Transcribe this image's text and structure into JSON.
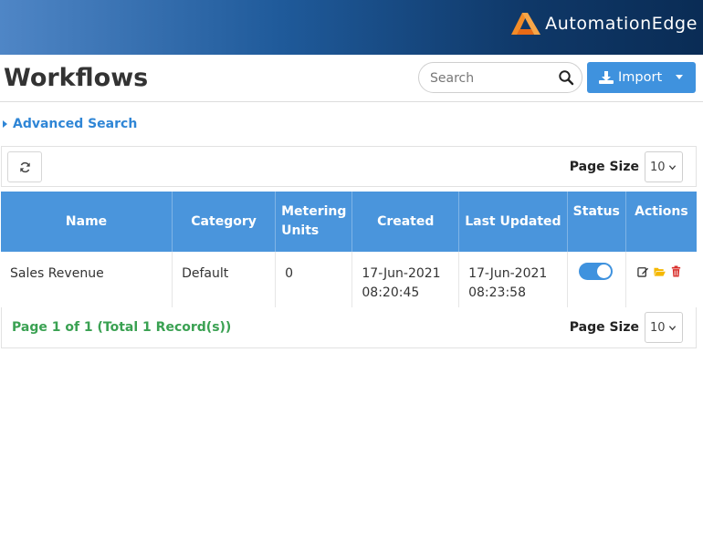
{
  "header": {
    "brand_name": "AutomationEdge"
  },
  "title_bar": {
    "page_title": "Workflows",
    "search_placeholder": "Search",
    "import_label": "Import"
  },
  "advanced_search_label": "Advanced Search",
  "toolbar": {
    "page_size_label": "Page Size",
    "page_size_value": "10"
  },
  "table": {
    "columns": [
      "Name",
      "Category",
      "Metering Units",
      "Created",
      "Last Updated",
      "Status",
      "Actions"
    ],
    "rows": [
      {
        "name": "Sales Revenue",
        "category": "Default",
        "metering_units": "0",
        "created_date": "17-Jun-2021",
        "created_time": "08:20:45",
        "updated_date": "17-Jun-2021",
        "updated_time": "08:23:58",
        "status_enabled": true
      }
    ]
  },
  "footer": {
    "record_info": "Page 1 of 1 (Total 1 Record(s))",
    "page_size_label": "Page Size",
    "page_size_value": "10"
  },
  "colors": {
    "accent": "#4a95dc",
    "success": "#3aa152",
    "brand_orange": "#f28c28",
    "delete": "#d9302c",
    "folder": "#f5b800"
  }
}
